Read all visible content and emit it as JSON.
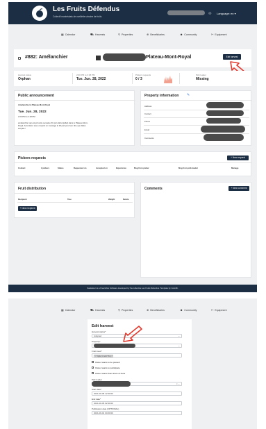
{
  "header": {
    "brand": "Les Fruits Défendus",
    "tagline": "Collectif montréalais de cueillette urbaine de fruits",
    "language_label": "Language: en ▾"
  },
  "nav": {
    "items": [
      {
        "icon": "▦",
        "label": "Calendar"
      },
      {
        "icon": "⛟",
        "label": "Harvests"
      },
      {
        "icon": "⚲",
        "label": "Properties"
      },
      {
        "icon": "⊕",
        "label": "Beneficiaries"
      },
      {
        "icon": "☻",
        "label": "Community"
      },
      {
        "icon": "✄",
        "label": "Equipment"
      }
    ]
  },
  "harvest": {
    "number_title": "#882: Amélanchier",
    "location": "Plateau-Mont-Royal",
    "edit_button": "Edit harvest"
  },
  "stats": {
    "status_label": "Harvest status",
    "status_value": "Orphan",
    "date_label": "2:00 PM to 3:18 PM",
    "date_value": "Tue. Jun. 28, 2022",
    "pickers_label": "Pickers requests",
    "pickers_value": "0 / 3",
    "leader_label": "Pick leader",
    "leader_value": "Missing"
  },
  "announcement": {
    "heading": "Public announcement",
    "line1": "Amélanchier ■ Plateau-Mont-Royal",
    "date": "Tue. Jun. 28, 2022",
    "time": "2:00 PM to 2:18 PM",
    "body1": "amélanchier qui est joli cette semaine (fin juin début juillet) dans le Plateau-Mont-",
    "body2": "Royal. Accordéon sous conjoint un message le 29 pair pour leur dire que faites",
    "body3": "est jolie !"
  },
  "property": {
    "heading": "Property information",
    "rows": [
      "Address",
      "Contact",
      "Phone",
      "Email",
      "Comments"
    ]
  },
  "pickers": {
    "heading": "Pickers requests",
    "new_button": "+ New request",
    "columns": [
      "Contact",
      "# pickers",
      "Status",
      "Requested on",
      "Accepted on",
      "Experience",
      "Msg from picker",
      "Msg from pick leader",
      "Manage"
    ]
  },
  "distribution": {
    "heading": "Fruit distribution",
    "columns": [
      "Recipient",
      "Tree",
      "Weight",
      "Delete"
    ],
    "new_button": "+ New recipient"
  },
  "comments": {
    "heading": "Comments",
    "new_button": "+ New comment"
  },
  "footer": {
    "text": "Saskatoon is a Free/Libre Software developed by the collective Les Fruits Défendus. Template by Colorlib."
  },
  "edit_form": {
    "heading": "Edit harvest",
    "status_label": "Harvest status*",
    "status_value": "Adopted",
    "property_label": "Property*",
    "fruit_label": "Fruit trees*",
    "fruit_tag": "× Digita (Lindstr Bos)",
    "checkbox1": "Owner wants to be present",
    "checkbox2": "Owner wants to participate",
    "checkbox3": "Owner wants their share of fruits",
    "leader_label": "Pick leader",
    "start_label": "Start date*",
    "start_value": "2021-06-05 12:30:00",
    "end_label": "End date*",
    "end_value": "2021-06-05 02:30:00",
    "publication_label": "Publication date (OPTIONAL)",
    "publication_value": "2021-06-01 04:00:00"
  },
  "colors": {
    "navy": "#1b2e44",
    "arrow_red": "#e23a2e",
    "background": "#eef0f2"
  }
}
